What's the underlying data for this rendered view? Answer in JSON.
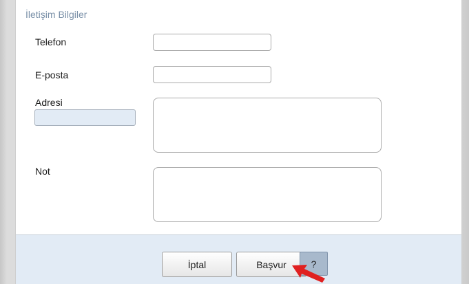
{
  "section": {
    "title": "İletişim Bilgiler"
  },
  "form": {
    "phone_label": "Telefon",
    "phone_value": "",
    "email_label": "E-posta",
    "email_value": "",
    "address_label": "Adresi",
    "address_value": "",
    "note_label": "Not",
    "note_value": ""
  },
  "footer": {
    "cancel_label": "İptal",
    "apply_label": "Başvur",
    "help_label": "?"
  },
  "colors": {
    "section_title": "#7a90a8",
    "footer_bg": "#e2ebf5",
    "help_button_bg": "#a8b9cc",
    "cursor": "#e02020"
  },
  "icons": {
    "pointer": "mouse-pointer-arrow-icon"
  }
}
